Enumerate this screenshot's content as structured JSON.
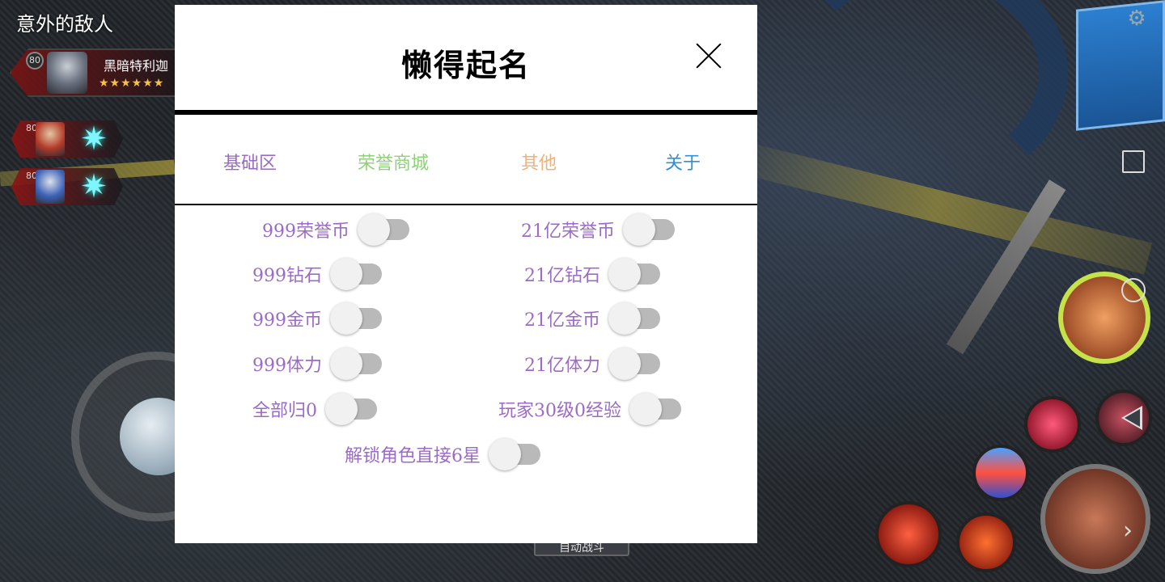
{
  "game": {
    "level_name": "意外的敌人",
    "hero": {
      "level": "80",
      "name": "黑暗特利迦",
      "stars": "★★★★★★"
    },
    "allies": [
      {
        "level": "80"
      },
      {
        "level": "80"
      }
    ],
    "auto_battle_label": "自动战斗"
  },
  "menu": {
    "title": "懒得起名",
    "tabs": [
      {
        "label": "基础区",
        "color": "#9b6bc6"
      },
      {
        "label": "荣誉商城",
        "color": "#8fd07a"
      },
      {
        "label": "其他",
        "color": "#f0b27a"
      },
      {
        "label": "关于",
        "color": "#2f8fd8"
      }
    ],
    "options": [
      {
        "label": "999荣誉币",
        "enabled": false
      },
      {
        "label": "21亿荣誉币",
        "enabled": false
      },
      {
        "label": "999钻石",
        "enabled": false
      },
      {
        "label": "21亿钻石",
        "enabled": false
      },
      {
        "label": "999金币",
        "enabled": false
      },
      {
        "label": "21亿金币",
        "enabled": false
      },
      {
        "label": "999体力",
        "enabled": false
      },
      {
        "label": "21亿体力",
        "enabled": false
      },
      {
        "label": "全部归0",
        "enabled": false
      },
      {
        "label": "玩家30级0经验",
        "enabled": false
      },
      {
        "label": "解锁角色直接6星",
        "enabled": false
      }
    ],
    "accent": "#9b6bc6"
  }
}
